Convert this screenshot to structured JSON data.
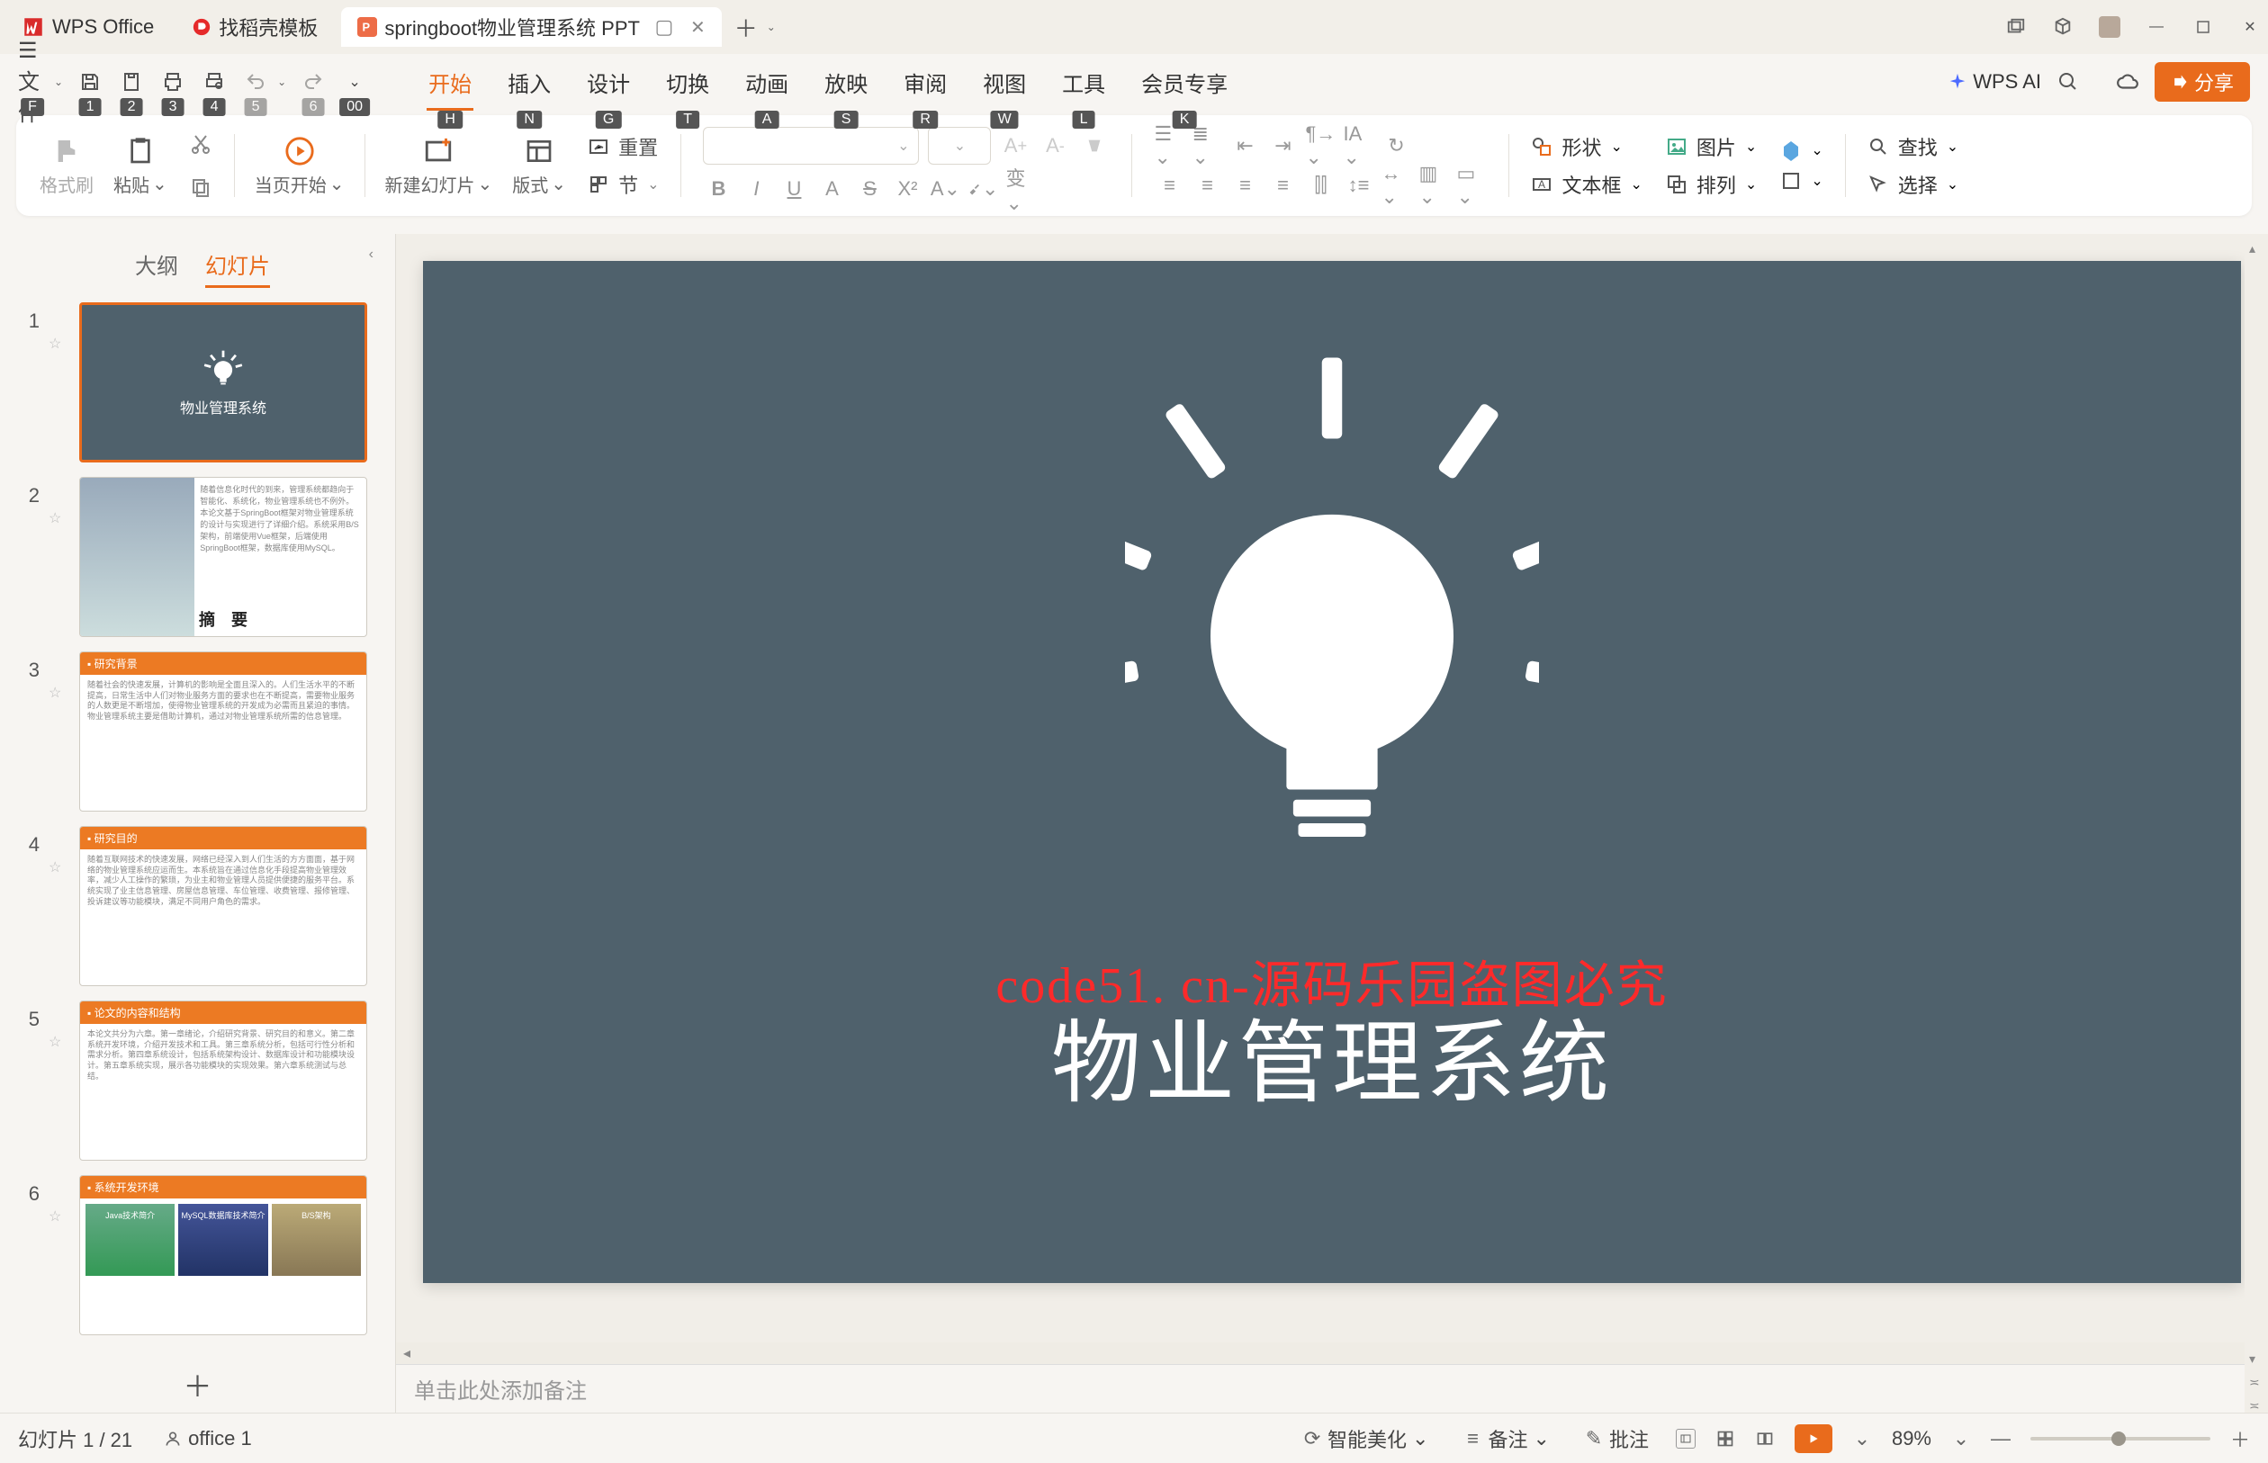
{
  "titlebar": {
    "app_name": "WPS Office",
    "tabs": [
      {
        "label": "找稻壳模板",
        "icon_color": "#e52a2a"
      },
      {
        "label": "springboot物业管理系统 PPT",
        "icon_color": "#ed6c47",
        "active": true
      }
    ]
  },
  "quickbar": {
    "file_label": "文件",
    "badges": {
      "file": "F",
      "save": "1",
      "saveas": "2",
      "print": "3",
      "export": "4",
      "undo": "5",
      "redo": "6",
      "more": "00"
    }
  },
  "menu": {
    "tabs": [
      {
        "label": "开始",
        "badge": "H",
        "active": true
      },
      {
        "label": "插入",
        "badge": "N"
      },
      {
        "label": "设计",
        "badge": "G"
      },
      {
        "label": "切换",
        "badge": "T"
      },
      {
        "label": "动画",
        "badge": "A"
      },
      {
        "label": "放映",
        "badge": "S"
      },
      {
        "label": "审阅",
        "badge": "R"
      },
      {
        "label": "视图",
        "badge": "W"
      },
      {
        "label": "工具",
        "badge": "L"
      },
      {
        "label": "会员专享",
        "badge": "K"
      }
    ],
    "ai_label": "WPS AI",
    "share_label": "分享"
  },
  "ribbon": {
    "format_painter": "格式刷",
    "paste": "粘贴",
    "from_current": "当页开始",
    "new_slide": "新建幻灯片",
    "layout": "版式",
    "section": "节",
    "reset": "重置",
    "shape": "形状",
    "picture": "图片",
    "textbox": "文本框",
    "arrange": "排列",
    "find": "查找",
    "select": "选择"
  },
  "pane": {
    "tabs": {
      "outline": "大纲",
      "slides": "幻灯片"
    },
    "active": "slides"
  },
  "thumbs": [
    {
      "num": "1",
      "kind": "title",
      "text": "物业管理系统",
      "selected": true
    },
    {
      "num": "2",
      "kind": "abstract",
      "title": "摘　要"
    },
    {
      "num": "3",
      "kind": "orange",
      "bar": "研究背景"
    },
    {
      "num": "4",
      "kind": "orange",
      "bar": "研究目的"
    },
    {
      "num": "5",
      "kind": "orange",
      "bar": "论文的内容和结构"
    },
    {
      "num": "6",
      "kind": "env",
      "bar": "系统开发环境",
      "cards": [
        "Java技术简介",
        "MySQL数据库技术简介",
        "B/S架构"
      ]
    }
  ],
  "slide": {
    "title": "物业管理系统",
    "watermark": "code51. cn-源码乐园盗图必究"
  },
  "notes_placeholder": "单击此处添加备注",
  "statusbar": {
    "slide_counter": "幻灯片 1 / 21",
    "author": "office 1",
    "beautify": "智能美化",
    "notes": "备注",
    "comments": "批注",
    "zoom_value": "89%",
    "zoom_percent": 45
  }
}
